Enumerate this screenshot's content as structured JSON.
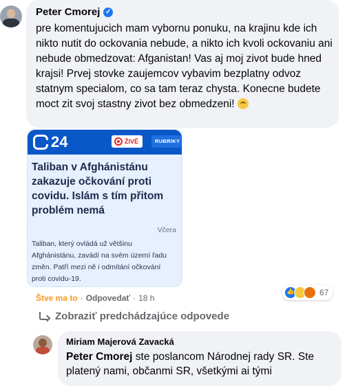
{
  "comment": {
    "author": "Peter Cmorej",
    "text": "pre komentujucich mam vybornu ponuku, na krajinu kde ich nikto nutit do ockovania nebude, a nikto ich kvoli ockovaniu ani nebude obmedzovat: Afganistan! Vas aj moj zivot bude hned krajsi! Prvej stovke zaujemcov vybavim bezplatny odvoz statnym specialom, co sa tam teraz chysta. Konecne budete moct zit svoj stastny zivot bez obmedzeni!",
    "emoji_icon": "upside-down-face-emoji",
    "actions": {
      "like_label": "Štve ma to",
      "reply_label": "Odpovedať",
      "separator": "·",
      "time": "18 h"
    },
    "reactions": {
      "icons": [
        "like-reaction-icon",
        "haha-reaction-icon",
        "angry-reaction-icon"
      ],
      "count": "67"
    }
  },
  "link_card": {
    "logo_text": "24",
    "live_label": "ŽIVĚ",
    "rubriky_label": "RUBRIKY",
    "headline": "Taliban v Afghánistánu zakazuje očkování proti covidu. Islám s tím přitom problém nemá",
    "date": "Včera",
    "summary": "Taliban, který ovládá už většinu Afghánistánu, zavádí na svém území řadu změn. Patří mezi ně i odmítání očkování proti covidu-19.",
    "colors": {
      "header": "#0a58c8",
      "card_bg": "#e6f0ff",
      "live": "#e0261f"
    }
  },
  "view_previous": {
    "label": "Zobraziť predchádzajúce odpovede"
  },
  "reply": {
    "author": "Miriam Majerová Zavacká",
    "mention": "Peter Cmorej",
    "text": "ste poslancom Národnej rady SR. Ste platený nami, občanmi SR, všetkými ai tými"
  },
  "colors": {
    "bubble": "#f0f2f5",
    "verified": "#1877f2",
    "like_action": "#f7971e",
    "muted": "#65676b"
  }
}
